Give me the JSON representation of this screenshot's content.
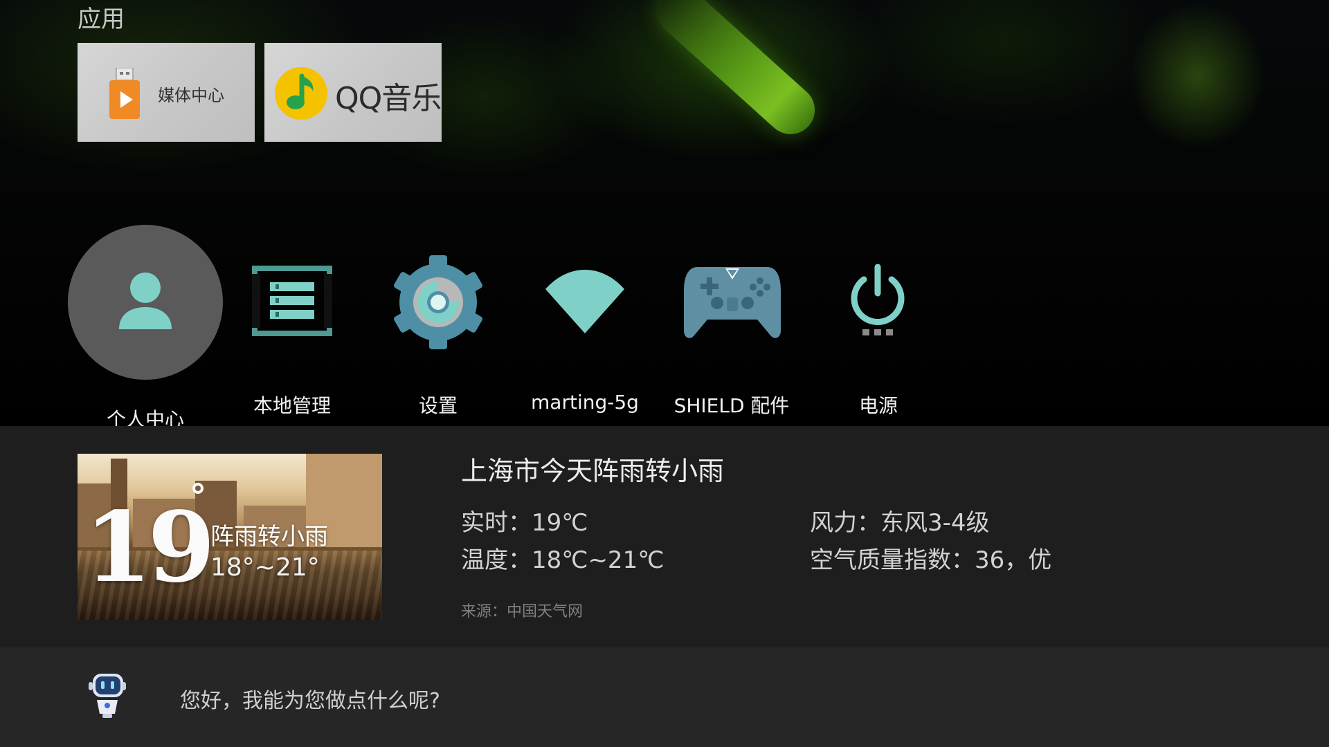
{
  "apps_section": {
    "label": "应用",
    "tiles": [
      {
        "label": "媒体中心",
        "icon": "usb-media-icon"
      },
      {
        "label": "QQ音乐",
        "icon": "qq-music-icon"
      }
    ]
  },
  "nav": [
    {
      "label": "个人中心",
      "icon": "person-icon"
    },
    {
      "label": "本地管理",
      "icon": "file-manager-icon"
    },
    {
      "label": "设置",
      "icon": "gear-icon"
    },
    {
      "label": "marting-5g",
      "icon": "wifi-icon"
    },
    {
      "label": "SHIELD 配件",
      "icon": "gamepad-icon"
    },
    {
      "label": "电源",
      "icon": "power-icon"
    }
  ],
  "weather": {
    "image_temp": "19",
    "image_condition": "阵雨转小雨",
    "image_range": "18°~21°",
    "title": "上海市今天阵雨转小雨",
    "realtime": "实时：19℃",
    "temperature": "温度：18℃~21℃",
    "wind": "风力：东风3-4级",
    "aqi": "空气质量指数：36，优",
    "source": "来源：中国天气网"
  },
  "assistant": {
    "prompt": "您好，我能为您做点什么呢?",
    "icon": "robot-icon"
  },
  "colors": {
    "accent_teal": "#7fd1c7",
    "panel_bg": "#1e1e1e",
    "assist_bg": "#262626",
    "tile_bg": "#cfcfcf"
  }
}
